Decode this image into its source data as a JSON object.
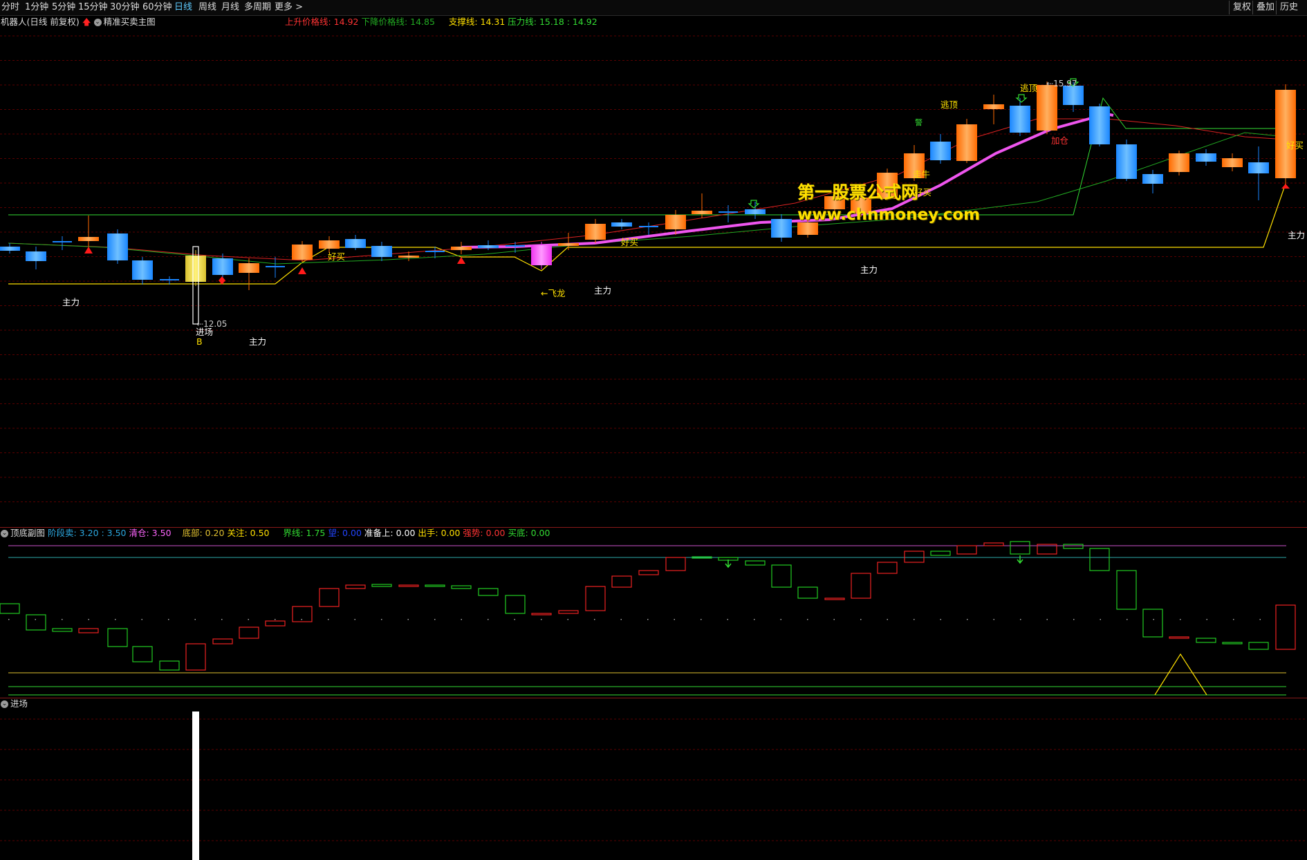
{
  "toolbar": {
    "periods": [
      "分时",
      "1分钟",
      "5分钟",
      "15分钟",
      "30分钟",
      "60分钟",
      "日线",
      "周线",
      "月线",
      "多周期",
      "更多 >"
    ],
    "active_period": "日线",
    "right_buttons": [
      "复权",
      "叠加",
      "历史"
    ]
  },
  "main_legend": {
    "title": "机器人(日线 前复权)",
    "indicator": "精准买卖主图",
    "items": [
      {
        "text": "上升价格线: 14.92",
        "color": "#ff3333"
      },
      {
        "text": "下降价格线: 14.85",
        "color": "#22aa22"
      },
      {
        "text": "支撑线: 14.31",
        "color": "#ffe000"
      },
      {
        "text": "压力线: 15.18 : 14.92",
        "color": "#33dd33"
      }
    ]
  },
  "sub_legend": {
    "title": "顶底副图",
    "items": [
      {
        "text": "阶段卖: 3.20 : 3.50",
        "color": "#2ca8e0"
      },
      {
        "text": "清仓: 3.50",
        "color": "#ff66ff"
      },
      {
        "text": "底部: 0.20",
        "color": "#e0c030"
      },
      {
        "text": "关注: 0.50",
        "color": "#ffe000"
      },
      {
        "text": "界线: 1.75",
        "color": "#33dd33"
      },
      {
        "text": "望: 0.00",
        "color": "#2244ff"
      },
      {
        "text": "准备上: 0.00",
        "color": "#ffffff"
      },
      {
        "text": "出手: 0.00",
        "color": "#ffe000"
      },
      {
        "text": "强势: 0.00",
        "color": "#ff3333"
      },
      {
        "text": "买底: 0.00",
        "color": "#33dd33"
      }
    ]
  },
  "vol_legend": {
    "title": "进场"
  },
  "price_markers": {
    "low": "12.05",
    "high": "15.97"
  },
  "signals": {
    "zhuli": "主力",
    "jinchang": "进场",
    "b": "B",
    "haomai": "好买",
    "feilong": "←飞龙",
    "zouniu": "走牛",
    "taoding": "逃顶",
    "jiaxin": "加仓",
    "jing": "警"
  },
  "watermark": {
    "line1": "第一股票公式网",
    "line2": "www.chnmoney.com"
  },
  "colors": {
    "up": "#ff6a00",
    "down": "#1a86ff",
    "magenta": "#ee33ee",
    "support": "#ffe000",
    "resistance": "#33dd33",
    "grid": "#5a0000"
  }
}
